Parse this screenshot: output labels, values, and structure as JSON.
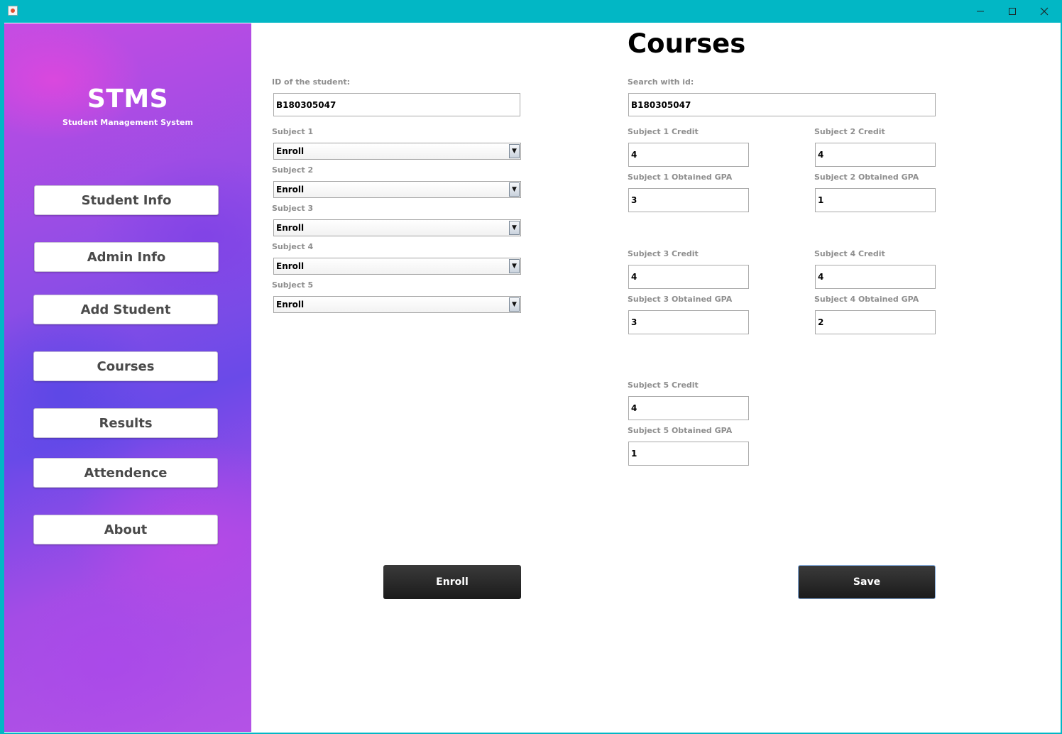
{
  "window": {
    "minimize_glyph": "minimize-icon",
    "maximize_glyph": "maximize-icon",
    "close_glyph": "close-icon",
    "accent": "#02b7c5"
  },
  "sidebar": {
    "title": "STMS",
    "subtitle": "Student Management System",
    "items": [
      {
        "label": "Student Info"
      },
      {
        "label": "Admin Info"
      },
      {
        "label": "Add Student"
      },
      {
        "label": "Courses"
      },
      {
        "label": "Results"
      },
      {
        "label": "Attendence"
      },
      {
        "label": "About"
      }
    ]
  },
  "main": {
    "title": "Courses",
    "enroll_form": {
      "student_id_label": "ID of the student:",
      "student_id_value": "B180305047",
      "subjects": [
        {
          "label": "Subject 1",
          "value": "Enroll"
        },
        {
          "label": "Subject 2",
          "value": "Enroll"
        },
        {
          "label": "Subject 3",
          "value": "Enroll"
        },
        {
          "label": "Subject 4",
          "value": "Enroll"
        },
        {
          "label": "Subject 5",
          "value": "Enroll"
        }
      ],
      "enroll_button": "Enroll"
    },
    "grades_form": {
      "search_label": "Search with id:",
      "search_value": "B180305047",
      "subjects": [
        {
          "credit_label": "Subject 1 Credit",
          "credit": "4",
          "gpa_label": "Subject 1 Obtained GPA",
          "gpa": "3"
        },
        {
          "credit_label": "Subject 2 Credit",
          "credit": "4",
          "gpa_label": "Subject 2 Obtained GPA",
          "gpa": "1"
        },
        {
          "credit_label": "Subject 3 Credit",
          "credit": "4",
          "gpa_label": "Subject 3 Obtained GPA",
          "gpa": "3"
        },
        {
          "credit_label": "Subject 4 Credit",
          "credit": "4",
          "gpa_label": "Subject 4 Obtained GPA",
          "gpa": "2"
        },
        {
          "credit_label": "Subject 5 Credit",
          "credit": "4",
          "gpa_label": "Subject 5 Obtained GPA",
          "gpa": "1"
        }
      ],
      "save_button": "Save"
    }
  }
}
